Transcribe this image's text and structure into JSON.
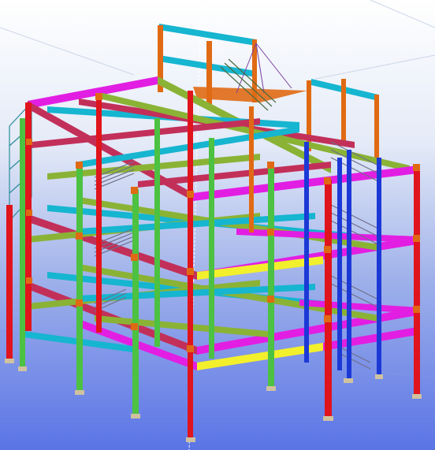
{
  "scene": {
    "subject": "steel-frame-structure",
    "background_colors": {
      "top": "#ffffff",
      "bottom": "#5a74e6"
    },
    "member_colors": {
      "column_red": "#e0141c",
      "column_green": "#4cc142",
      "column_blue": "#1c39d6",
      "column_orange": "#e06a14",
      "beam_magenta": "#e21ee3",
      "beam_maroon": "#c2305a",
      "beam_olive": "#8ab336",
      "beam_cyan": "#16b5d0",
      "beam_yellow": "#f2ef2c",
      "stair_grey": "#6f6f8a",
      "gridline_white": "#ffffff",
      "base_plate": "#cfc2a0"
    }
  }
}
